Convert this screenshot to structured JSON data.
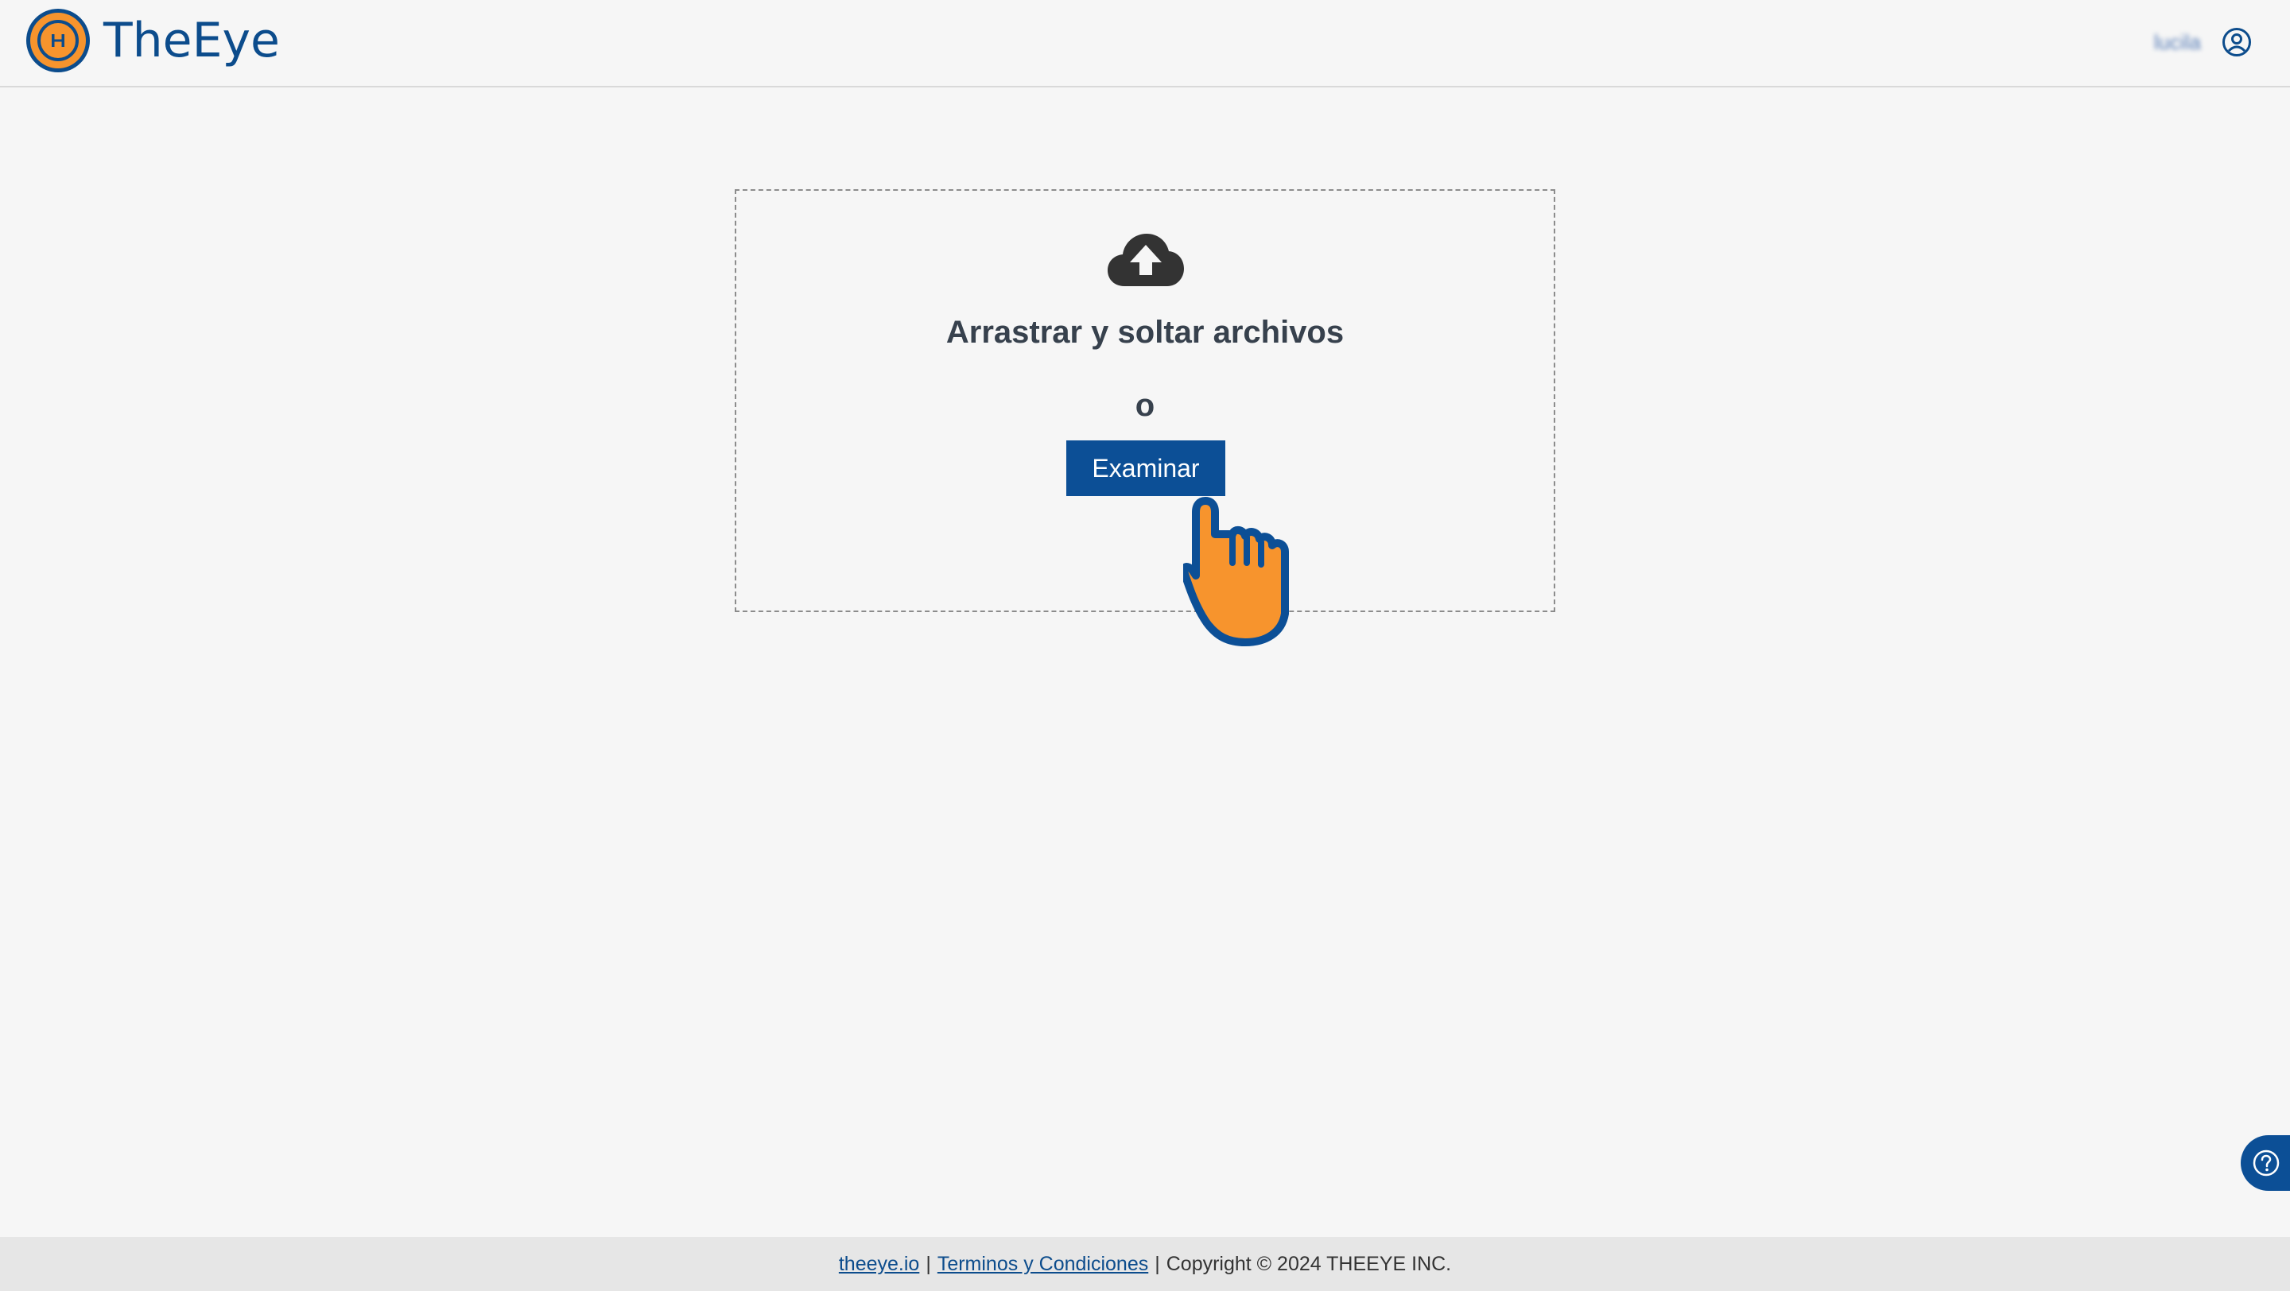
{
  "header": {
    "brand_name": "TheEye",
    "username": "lucila",
    "brand_color": "#0c4c8c",
    "accent_color": "#f7942d"
  },
  "dropzone": {
    "title": "Arrastrar y soltar archivos",
    "or_text": "o",
    "browse_label": "Examinar",
    "icon": "cloud-upload-icon"
  },
  "help": {
    "icon": "question-circle-icon"
  },
  "footer": {
    "link_site": "theeye.io",
    "separator_1": "|",
    "link_terms": "Terminos y Condiciones",
    "separator_2": "|",
    "copyright": "Copyright © 2024 THEEYE INC."
  }
}
